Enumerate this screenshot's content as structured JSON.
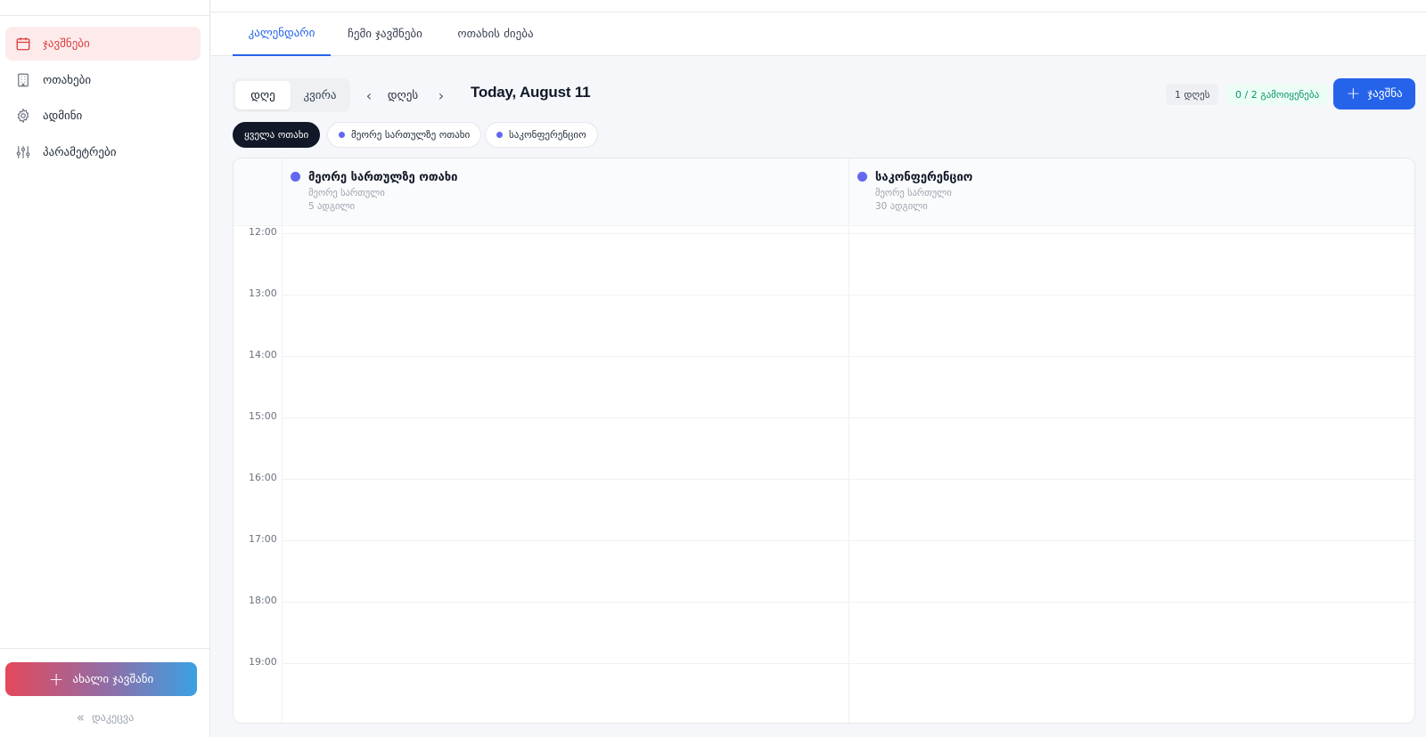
{
  "sidebar": {
    "items": [
      {
        "label": "ჯავშნები",
        "icon": "calendar-icon",
        "active": true
      },
      {
        "label": "ოთახები",
        "icon": "building-icon",
        "active": false
      },
      {
        "label": "ადმინი",
        "icon": "gear-icon",
        "active": false
      },
      {
        "label": "პარამეტრები",
        "icon": "sliders-icon",
        "active": false
      }
    ],
    "new_booking_label": "ახალი ჯავშანი",
    "collapse_label": "დაკეცვა"
  },
  "tabs": [
    "კალენდარი",
    "ჩემი ჯავშნები",
    "ოთახის ძიება"
  ],
  "toolbar": {
    "view_day": "დღე",
    "view_week": "კვირა",
    "prev_icon": "chevron-left-icon",
    "next_icon": "chevron-right-icon",
    "today_label": "დღეს",
    "date_title": "Today, August 11",
    "count_pill": "1 დღეს",
    "usage_pill": "0 / 2 გამოიყენება",
    "add_label": "ჯავშნა"
  },
  "filters": {
    "all": "ყველა ოთახი",
    "rooms": [
      "მეორე სართულზე ოთახი",
      "საკონფერენციო"
    ]
  },
  "calendar": {
    "rooms": [
      {
        "name": "მეორე სართულზე ოთახი",
        "floor": "მეორე სართული",
        "capacity": "5 ადგილი"
      },
      {
        "name": "საკონფერენციო",
        "floor": "მეორე სართული",
        "capacity": "30 ადგილი"
      }
    ],
    "hours": [
      "12:00",
      "13:00",
      "14:00",
      "15:00",
      "16:00",
      "17:00",
      "18:00",
      "19:00"
    ]
  },
  "colors": {
    "accent": "#2563eb",
    "active_nav_bg": "#fdebec",
    "active_nav_text": "#dc3e3e",
    "room_dot": "#6366f1",
    "usage_text": "#059669"
  }
}
